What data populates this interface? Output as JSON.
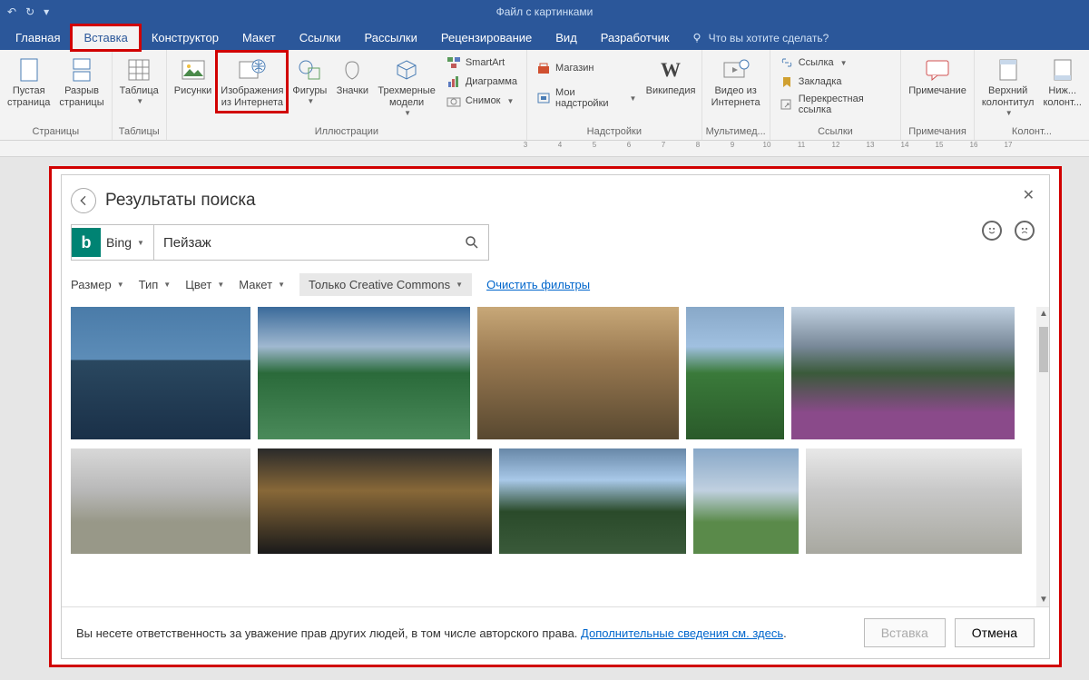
{
  "titlebar": {
    "doc_title": "Файл с картинками"
  },
  "tabs": {
    "items": [
      "Главная",
      "Вставка",
      "Конструктор",
      "Макет",
      "Ссылки",
      "Рассылки",
      "Рецензирование",
      "Вид",
      "Разработчик"
    ],
    "tell_me": "Что вы хотите сделать?"
  },
  "ribbon": {
    "pages": {
      "label": "Страницы",
      "blank": "Пустая\nстраница",
      "break": "Разрыв\nстраницы"
    },
    "tables": {
      "label": "Таблицы",
      "table": "Таблица"
    },
    "illus": {
      "label": "Иллюстрации",
      "pictures": "Рисунки",
      "online_pic": "Изображения\nиз Интернета",
      "shapes": "Фигуры",
      "icons": "Значки",
      "threed": "Трехмерные\nмодели",
      "smartart": "SmartArt",
      "chart": "Диаграмма",
      "screenshot": "Снимок"
    },
    "addins": {
      "label": "Надстройки",
      "store": "Магазин",
      "myaddins": "Мои надстройки",
      "wiki": "Википедия"
    },
    "media": {
      "label": "Мультимед...",
      "video": "Видео из\nИнтернета"
    },
    "links": {
      "label": "Ссылки",
      "link": "Ссылка",
      "bookmark": "Закладка",
      "crossref": "Перекрестная ссылка"
    },
    "comments": {
      "label": "Примечания",
      "comment": "Примечание"
    },
    "hf": {
      "label": "Колонт...",
      "header": "Верхний\nколонтитул",
      "footer": "Ниж...\nколонт..."
    }
  },
  "ruler": [
    "3",
    "4",
    "5",
    "6",
    "7",
    "8",
    "9",
    "10",
    "11",
    "12",
    "13",
    "14",
    "15",
    "16",
    "17"
  ],
  "dialog": {
    "title": "Результаты поиска",
    "bing": "Bing",
    "search_value": "Пейзаж",
    "filters": {
      "size": "Размер",
      "type": "Тип",
      "color": "Цвет",
      "layout": "Макет",
      "cc": "Только Creative Commons",
      "clear": "Очистить фильтры"
    },
    "footer_note_a": "Вы несете ответственность за уважение прав других людей, в том числе авторского права. ",
    "footer_link": "Дополнительные сведения см. здесь",
    "insert": "Вставка",
    "cancel": "Отмена"
  }
}
